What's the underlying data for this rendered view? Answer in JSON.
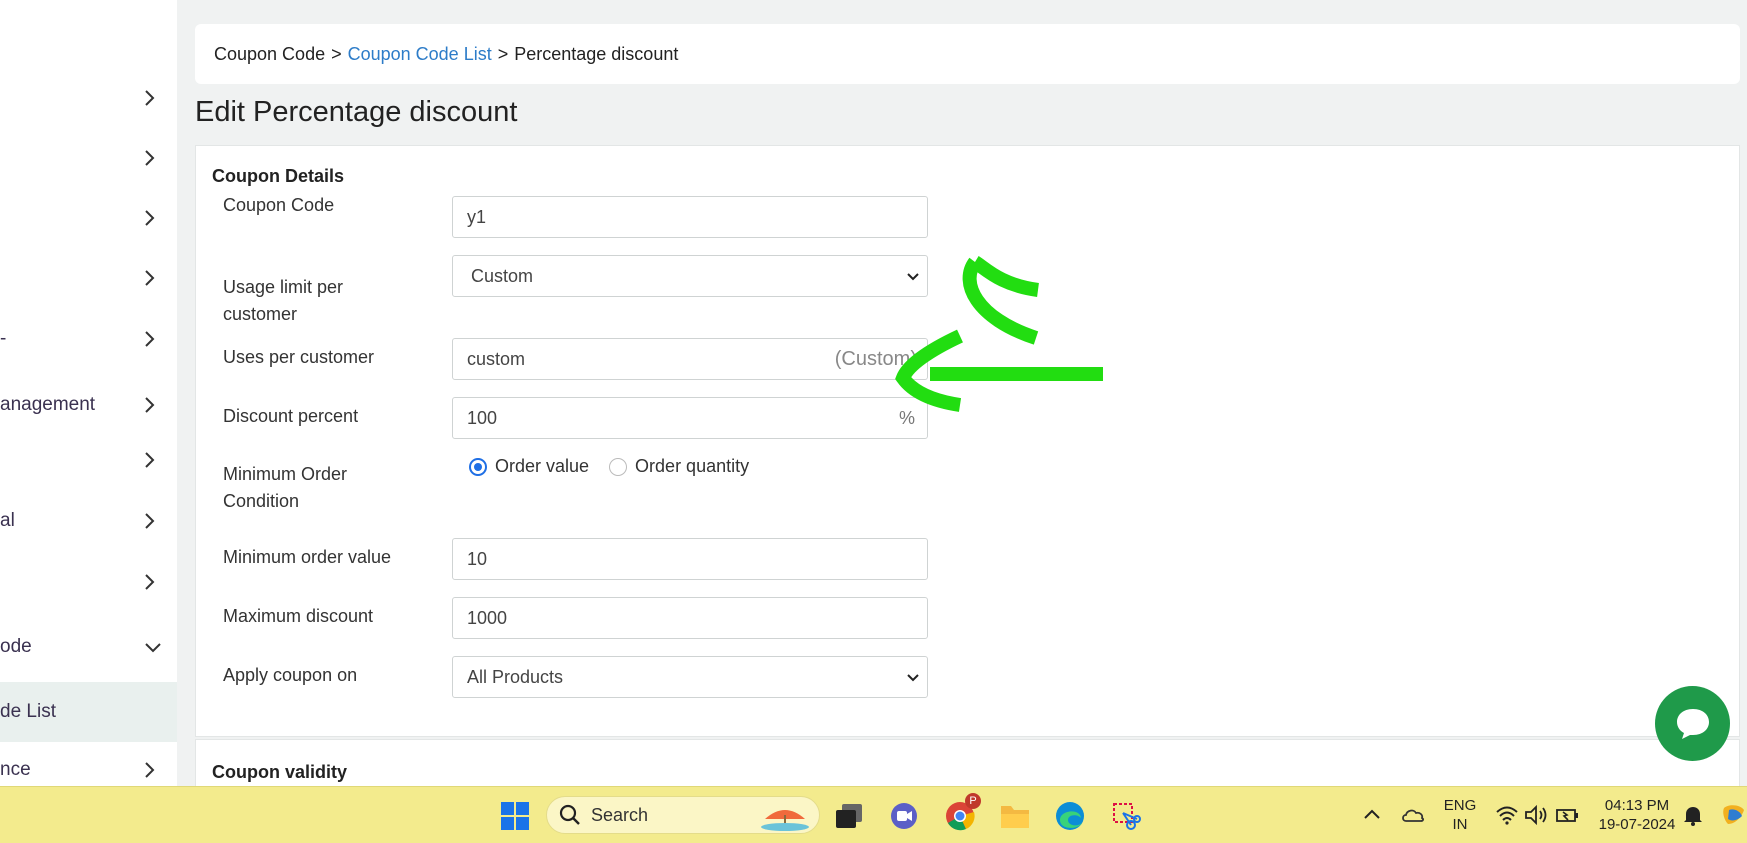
{
  "sidebar": {
    "items": [
      {
        "label": "",
        "icon": "chevron-right-icon"
      },
      {
        "label": "",
        "icon": "chevron-right-icon"
      },
      {
        "label": "",
        "icon": "chevron-right-icon"
      },
      {
        "label": "",
        "icon": "chevron-right-icon"
      },
      {
        "label": "-",
        "icon": "chevron-right-icon"
      },
      {
        "label": "anagement",
        "icon": "chevron-right-icon"
      },
      {
        "label": "",
        "icon": "chevron-right-icon"
      },
      {
        "label": "al",
        "icon": "chevron-right-icon"
      },
      {
        "label": "",
        "icon": "chevron-right-icon"
      },
      {
        "label": "ode",
        "icon": "chevron-down-icon"
      },
      {
        "label": "de List",
        "icon": ""
      },
      {
        "label": "nce",
        "icon": "chevron-right-icon"
      }
    ]
  },
  "breadcrumb": {
    "root": "Coupon Code",
    "sep": ">",
    "link": "Coupon Code List",
    "current": "Percentage discount"
  },
  "page_title": "Edit Percentage discount",
  "coupon_details": {
    "title": "Coupon Details",
    "coupon_code_label": "Coupon Code",
    "coupon_code_value": "y1",
    "usage_limit_label_1": "Usage limit per",
    "usage_limit_label_2": "customer",
    "usage_limit_value": "Custom",
    "uses_per_customer_label": "Uses per customer",
    "uses_per_customer_value": "custom",
    "uses_per_customer_suffix": "(Custom)",
    "discount_percent_label": "Discount percent",
    "discount_percent_value": "100",
    "discount_percent_suffix": "%",
    "min_order_condition_label_1": "Minimum Order",
    "min_order_condition_label_2": "Condition",
    "radio_order_value": "Order value",
    "radio_order_quantity": "Order quantity",
    "min_order_value_label": "Minimum order value",
    "min_order_value_value": "10",
    "max_discount_label": "Maximum discount",
    "max_discount_value": "1000",
    "apply_on_label": "Apply coupon on",
    "apply_on_value": "All Products"
  },
  "coupon_validity": {
    "title": "Coupon validity"
  },
  "taskbar": {
    "search_label": "Search",
    "lang_1": "ENG",
    "lang_2": "IN",
    "time": "04:13 PM",
    "date": "19-07-2024",
    "chrome_badge": "P"
  },
  "colors": {
    "accent": "#1f6fe5",
    "link": "#2d7cc8",
    "chat": "#1f9a4a",
    "annotation": "#22dd11",
    "taskbar": "#f3eb8d"
  }
}
